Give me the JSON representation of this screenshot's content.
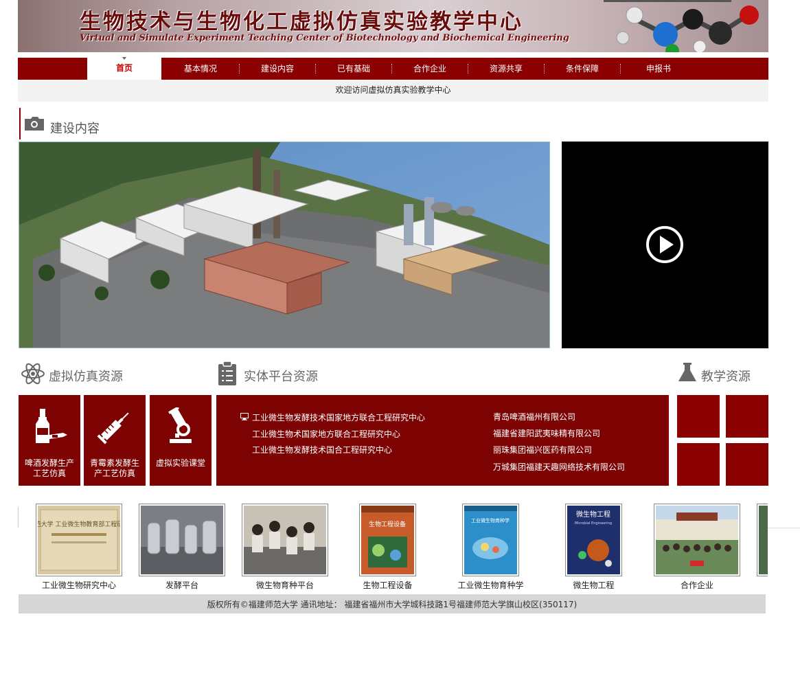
{
  "header": {
    "title_cn": "生物技术与生物化工虚拟仿真实验教学中心",
    "title_en": "Virtual and Simulate Experiment Teaching Center of Biotechnology and Biochemical Engineering"
  },
  "nav": {
    "items": [
      "首页",
      "基本情况",
      "建设内容",
      "已有基础",
      "合作企业",
      "资源共享",
      "条件保障",
      "申报书"
    ],
    "active_index": 0
  },
  "welcome": "欢迎访问虚拟仿真实验教学中心",
  "section_title": "建设内容",
  "resources": {
    "virtual_title": "虚拟仿真资源",
    "platform_title": "实体平台资源",
    "teaching_title": "教学资源"
  },
  "tiles": [
    {
      "label": "啤酒发酵生产工艺仿真",
      "icon": "beer-bottle-icon"
    },
    {
      "label": "青霉素发酵生产工艺仿真",
      "icon": "syringe-icon"
    },
    {
      "label": "虚拟实验课堂",
      "icon": "microscope-icon"
    }
  ],
  "platform_links": {
    "left": [
      "工业微生物发酵技术国家地方联合工程研究中心",
      "工业微生物术国家地方联合工程研究中心",
      "工业微生物发酵技术国合工程研究中心"
    ],
    "right": [
      "青岛啤酒福州有限公司",
      "福建省建阳武夷味精有限公司",
      "丽珠集团福兴医药有限公司",
      "万城集团福建天趣网络技术有限公司"
    ]
  },
  "gallery": [
    "工业微生物研究中心",
    "发酵平台",
    "微生物育种平台",
    "生物工程设备",
    "工业微生物育种学",
    "微生物工程",
    "合作企业"
  ],
  "gallery_inner_text": {
    "plaque": "福建师范大学 工业微生物教育部工程研究中心",
    "book1": "生物工程设备",
    "book2": "工业微生物育种学",
    "book3_cn": "微生物工程",
    "book3_en": "Microbial Engineering"
  },
  "footer": "版权所有©福建师范大学 通讯地址： 福建省福州市大学城科技路1号福建师范大学旗山校区(350117)",
  "colors": {
    "brand_red": "#8b0000",
    "tile_red": "#7d0303",
    "welcome_bg": "#f2f2f2",
    "footer_bg": "#d6d6d6"
  }
}
